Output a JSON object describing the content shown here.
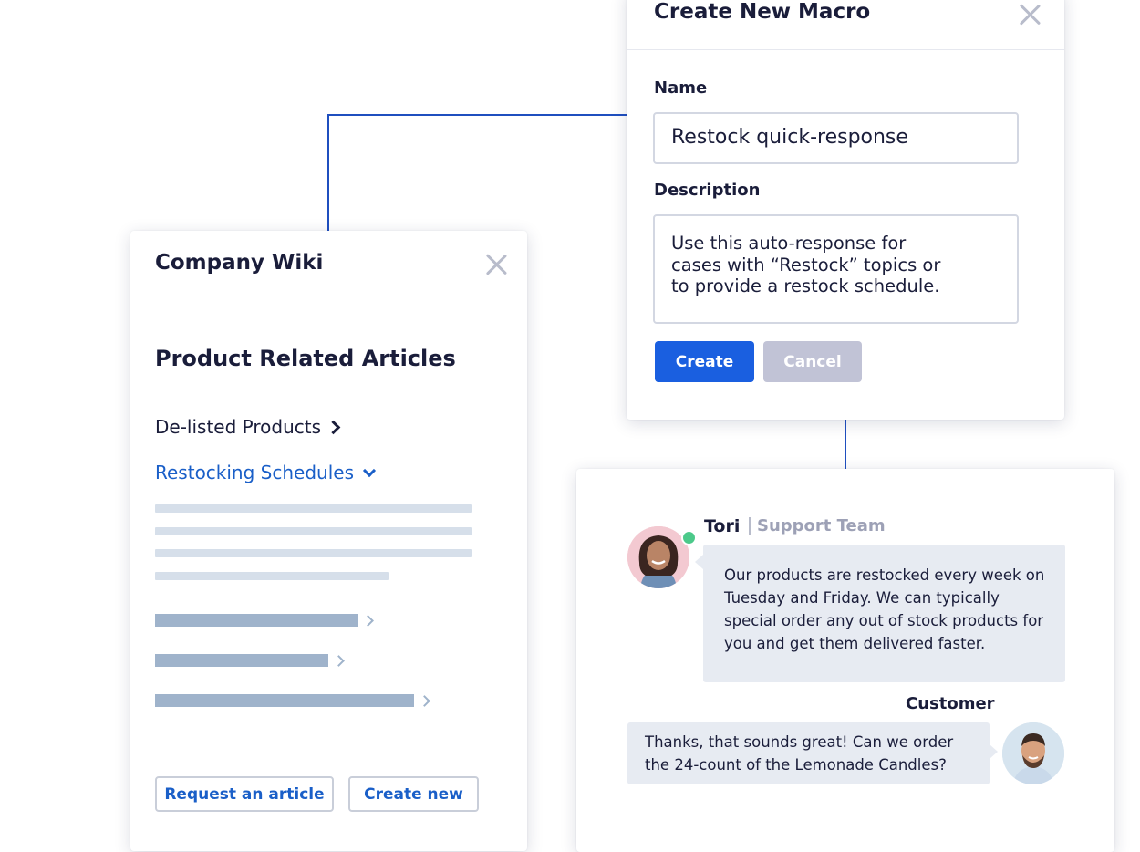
{
  "macro_modal": {
    "title": "Create New Macro",
    "name_label": "Name",
    "name_value": "Restock quick-response",
    "description_label": "Description",
    "description_value": "Use this auto-response for\ncases with “Restock” topics or\nto provide a restock schedule.",
    "create_label": "Create",
    "cancel_label": "Cancel"
  },
  "wiki": {
    "title": "Company Wiki",
    "section_title": "Product Related Articles",
    "links": [
      {
        "label": "De-listed Products"
      },
      {
        "label": "Restocking Schedules"
      }
    ],
    "request_label": "Request an article",
    "create_new_label": "Create new"
  },
  "chat": {
    "agent_name": "Tori",
    "agent_team": "Support Team",
    "agent_message": "Our products are restocked every week on Tuesday and Friday. We can typically special order any out of stock products for you and get them delivered faster.",
    "customer_name": "Customer",
    "customer_message": "Thanks, that sounds great! Can we order the 24-count of the Lemonade Candles?"
  },
  "colors": {
    "accent_blue": "#1a5fe0",
    "link_blue": "#1a5fc8",
    "connector": "#1f4fbf",
    "online_green": "#4cc98a"
  }
}
